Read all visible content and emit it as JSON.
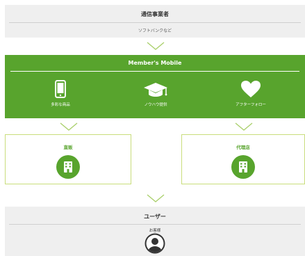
{
  "carrier": {
    "title": "通信事業者",
    "subtitle": "ソフトバンクなど"
  },
  "member": {
    "title": "Member's Mobile",
    "features": [
      {
        "label": "多彩な商品",
        "icon": "smartphone-icon"
      },
      {
        "label": "ノウハウ提供",
        "icon": "graduation-cap-icon"
      },
      {
        "label": "アフターフォロー",
        "icon": "heart-icon"
      }
    ]
  },
  "channels": [
    {
      "label": "直販",
      "icon": "building-icon"
    },
    {
      "label": "代理店",
      "icon": "building-icon"
    }
  ],
  "user": {
    "title": "ユーザー",
    "subtitle": "お客様",
    "icon": "user-avatar-icon"
  },
  "colors": {
    "green": "#58a42d",
    "light_green_border": "#c9dd7c",
    "gray_panel": "#efefef",
    "chevron": "#a9cf6a"
  }
}
